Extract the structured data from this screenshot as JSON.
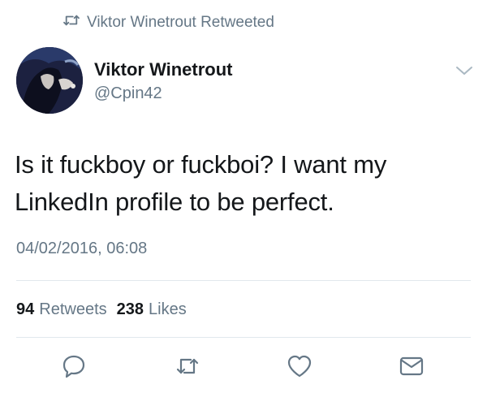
{
  "social_context": {
    "icon": "retweet-icon",
    "text": "Viktor Winetrout Retweeted"
  },
  "author": {
    "name": "Viktor Winetrout",
    "handle": "@Cpin42",
    "avatar_icon": "avatar-illustration"
  },
  "tweet": {
    "line1": "Is it fuckboy or fuckboi? I want my",
    "line2": "LinkedIn profile to be perfect.",
    "timestamp": "04/02/2016, 06:08"
  },
  "stats": {
    "retweets_count": "94",
    "retweets_label": "Retweets",
    "likes_count": "238",
    "likes_label": "Likes"
  },
  "actions": [
    "reply-icon",
    "retweet-icon",
    "like-icon",
    "message-icon"
  ],
  "colors": {
    "primary_text": "#14171a",
    "secondary_text": "#657786",
    "divider": "#e1e8ed"
  }
}
